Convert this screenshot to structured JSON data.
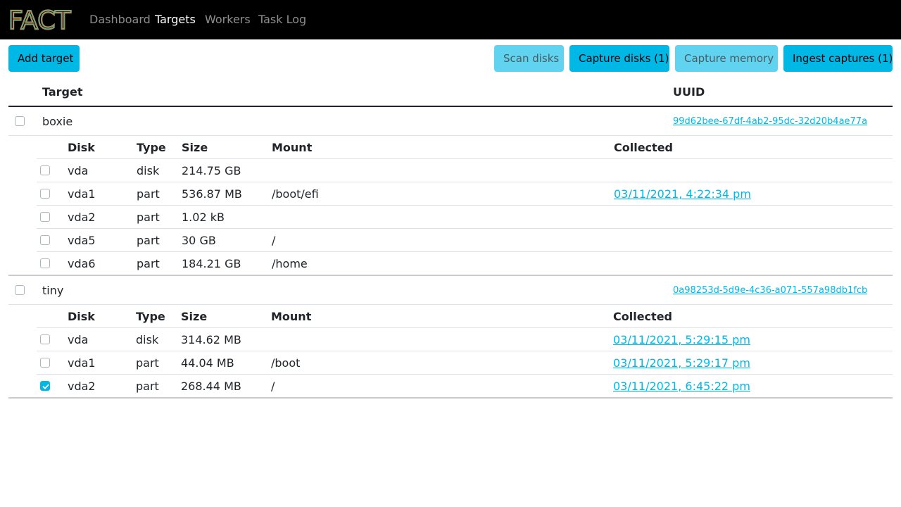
{
  "app": {
    "brand": "FACT",
    "nav": [
      {
        "label": "Dashboard",
        "active": false
      },
      {
        "label": "Targets",
        "active": true
      },
      {
        "label": "Workers",
        "active": false
      },
      {
        "label": "Task Log",
        "active": false
      }
    ]
  },
  "toolbar": {
    "add_target": "Add target",
    "scan_disks": "Scan disks",
    "capture_disks": "Capture disks (1)",
    "capture_memory": "Capture memory",
    "ingest_captures": "Ingest captures (1)"
  },
  "table": {
    "headers": {
      "target": "Target",
      "uuid": "UUID"
    },
    "disk_headers": {
      "disk": "Disk",
      "type": "Type",
      "size": "Size",
      "mount": "Mount",
      "collected": "Collected"
    },
    "targets": [
      {
        "name": "boxie",
        "uuid": "99d62bee-67df-4ab2-95dc-32d20b4ae77a",
        "checked": false,
        "disks": [
          {
            "disk": "vda",
            "type": "disk",
            "size": "214.75 GB",
            "mount": "",
            "collected": "",
            "checked": false
          },
          {
            "disk": "vda1",
            "type": "part",
            "size": "536.87 MB",
            "mount": "/boot/efi",
            "collected": "03/11/2021, 4:22:34 pm",
            "checked": false
          },
          {
            "disk": "vda2",
            "type": "part",
            "size": "1.02 kB",
            "mount": "",
            "collected": "",
            "checked": false
          },
          {
            "disk": "vda5",
            "type": "part",
            "size": "30 GB",
            "mount": "/",
            "collected": "",
            "checked": false
          },
          {
            "disk": "vda6",
            "type": "part",
            "size": "184.21 GB",
            "mount": "/home",
            "collected": "",
            "checked": false
          }
        ]
      },
      {
        "name": "tiny",
        "uuid": "0a98253d-5d9e-4c36-a071-557a98db1fcb",
        "checked": false,
        "disks": [
          {
            "disk": "vda",
            "type": "disk",
            "size": "314.62 MB",
            "mount": "",
            "collected": "03/11/2021, 5:29:15 pm",
            "checked": false
          },
          {
            "disk": "vda1",
            "type": "part",
            "size": "44.04 MB",
            "mount": "/boot",
            "collected": "03/11/2021, 5:29:17 pm",
            "checked": false
          },
          {
            "disk": "vda2",
            "type": "part",
            "size": "268.44 MB",
            "mount": "/",
            "collected": "03/11/2021, 6:45:22 pm",
            "checked": true
          }
        ]
      }
    ]
  },
  "colors": {
    "accent": "#00b8e6",
    "navbar": "#000000",
    "brand_stroke": "#f08a24"
  }
}
